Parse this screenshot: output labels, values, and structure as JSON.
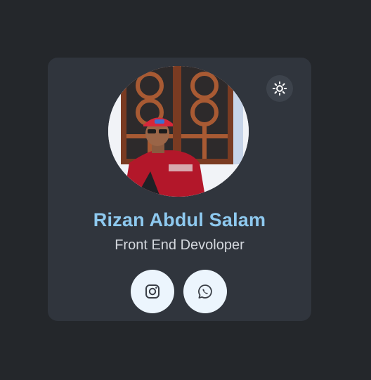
{
  "profile": {
    "name": "Rizan Abdul Salam",
    "role": "Front End Devoloper"
  },
  "icons": {
    "theme_toggle": "gear-icon",
    "instagram": "instagram-icon",
    "whatsapp": "whatsapp-icon"
  },
  "colors": {
    "background": "#24272b",
    "card": "#30353d",
    "name": "#8ec9ef",
    "role": "#d4d8de",
    "social_button": "#ecf5fd"
  }
}
